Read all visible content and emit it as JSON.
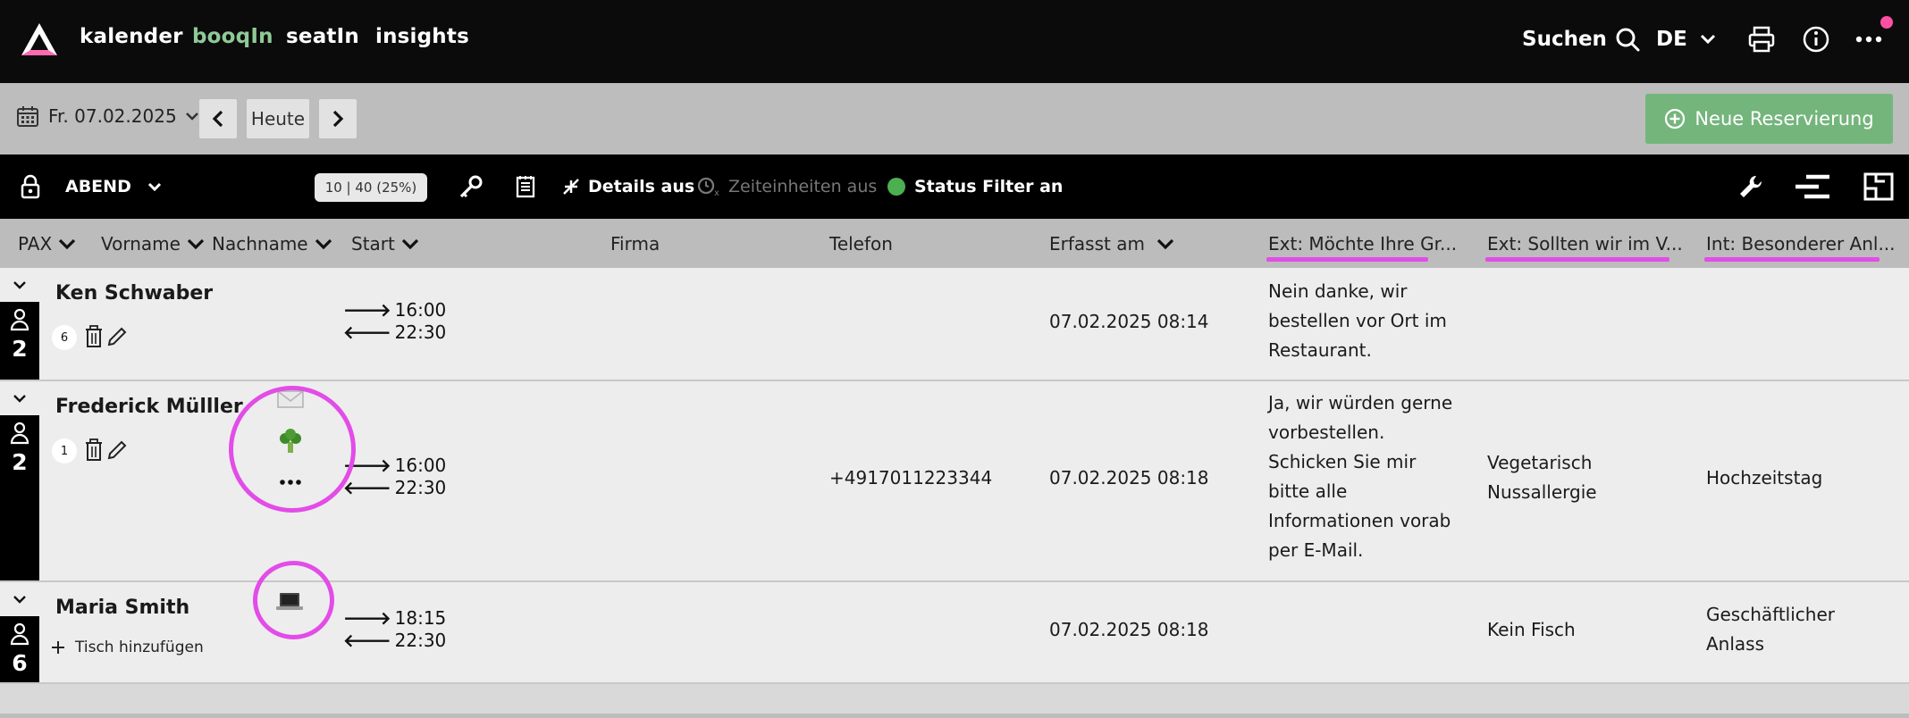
{
  "nav": {
    "logo_icon": "triangle-logo-icon",
    "links": [
      "kalender",
      "booqIn",
      "seatIn",
      "insights"
    ],
    "active": "booqIn",
    "search_label": "Suchen",
    "language": "DE"
  },
  "datebar": {
    "date": "Fr. 07.02.2025",
    "today_label": "Heute",
    "new_reservation_label": "Neue Reservierung"
  },
  "toolbar": {
    "shift": "ABEND",
    "capacity": "10 | 40 (25%)",
    "details_label": "Details aus",
    "time_units_label": "Zeiteinheiten aus",
    "status_filter_label": "Status Filter an"
  },
  "columns": {
    "pax": "PAX",
    "vorname": "Vorname",
    "nachname": "Nachname",
    "start": "Start",
    "firma": "Firma",
    "telefon": "Telefon",
    "erfasst": "Erfasst am",
    "ext1": "Ext: Möchte Ihre Gr...",
    "ext2": "Ext: Sollten wir im V...",
    "int1": "Int: Besonderer Anl..."
  },
  "rows": [
    {
      "name": "Ken Schwaber",
      "pax": "2",
      "table": "6",
      "start": "16:00",
      "end": "22:30",
      "telefon": "",
      "erfasst": "07.02.2025 08:14",
      "ext1": [
        "Nein danke, wir",
        "bestellen vor Ort im",
        "Restaurant."
      ],
      "ext2": [],
      "int1": []
    },
    {
      "name": "Frederick Mülller",
      "pax": "2",
      "table": "1",
      "start": "16:00",
      "end": "22:30",
      "telefon": "+4917011223344",
      "erfasst": "07.02.2025 08:18",
      "ext1": [
        "Ja, wir würden gerne",
        "vorbestellen.",
        "Schicken Sie mir",
        "bitte alle",
        "Informationen vorab",
        "per E-Mail."
      ],
      "ext2": [
        "Vegetarisch",
        "Nussallergie"
      ],
      "int1": [
        "Hochzeitstag"
      ]
    },
    {
      "name": "Maria Smith",
      "pax": "6",
      "add_table_label": "Tisch hinzufügen",
      "start": "18:15",
      "end": "22:30",
      "telefon": "",
      "erfasst": "07.02.2025 08:18",
      "ext1": [],
      "ext2": [
        "Kein Fisch"
      ],
      "int1": [
        "Geschäftlicher",
        "Anlass"
      ]
    }
  ],
  "colors": {
    "nav_bg": "#0b0b0b",
    "active_link": "#8fca96",
    "new_reservation": "#74b57c",
    "highlight": "#e24ce8",
    "status_green": "#4caf50",
    "notification": "#ff4fa3"
  }
}
